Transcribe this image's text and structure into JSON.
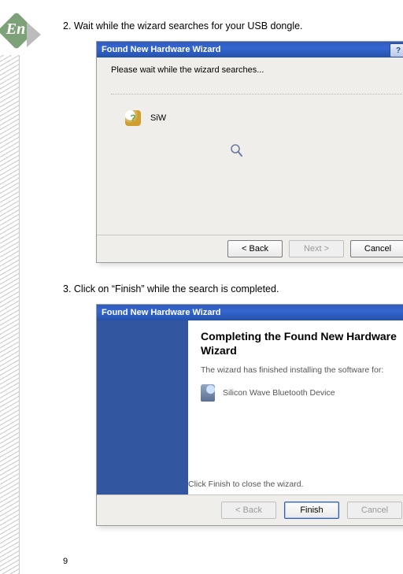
{
  "badge": {
    "lang": "En"
  },
  "page_number": "9",
  "steps": {
    "s2": "2. Wait while the wizard searches for your USB dongle.",
    "s3": "3. Click on “Finish” while the search is completed."
  },
  "window1": {
    "title": "Found New Hardware Wizard",
    "help_btn": "?",
    "instruction": "Please wait while the wizard searches...",
    "search_label": "SiW",
    "buttons": {
      "back": "< Back",
      "next": "Next >",
      "cancel": "Cancel"
    }
  },
  "window2": {
    "title": "Found New Hardware Wizard",
    "heading": "Completing the Found New Hardware Wizard",
    "subtext": "The wizard has finished installing the software for:",
    "device": "Silicon Wave Bluetooth Device",
    "footer": "Click Finish to close the wizard.",
    "buttons": {
      "back": "< Back",
      "finish": "Finish",
      "cancel": "Cancel"
    }
  }
}
